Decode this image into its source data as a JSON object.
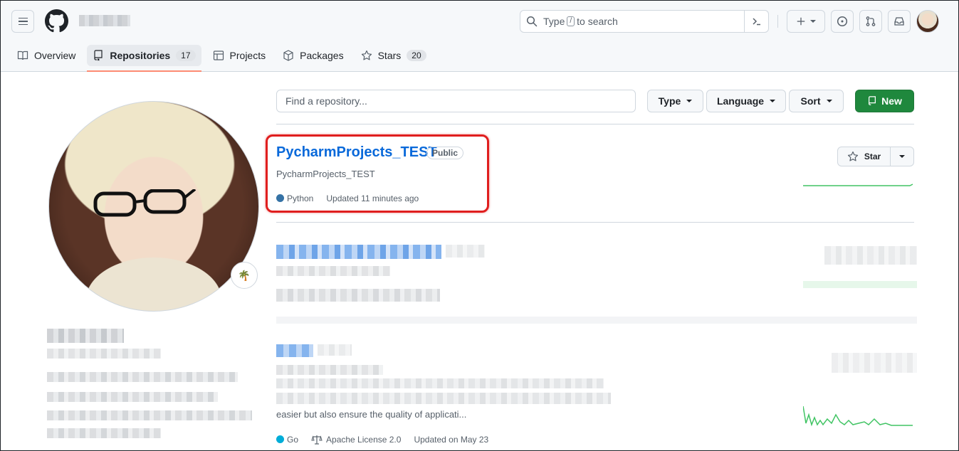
{
  "header": {
    "search_prefix": "Type",
    "search_key": "/",
    "search_suffix": "to search"
  },
  "tabs": [
    {
      "label": "Overview",
      "count": null
    },
    {
      "label": "Repositories",
      "count": "17"
    },
    {
      "label": "Projects",
      "count": null
    },
    {
      "label": "Packages",
      "count": null
    },
    {
      "label": "Stars",
      "count": "20"
    }
  ],
  "filters": {
    "find_placeholder": "Find a repository...",
    "type_label": "Type",
    "language_label": "Language",
    "sort_label": "Sort",
    "new_label": "New"
  },
  "repos": [
    {
      "name": "PycharmProjects_TEST",
      "visibility": "Public",
      "description": "PycharmProjects_TEST",
      "language": "Python",
      "language_color": "#3572A5",
      "updated": "Updated 11 minutes ago",
      "star_label": "Star"
    },
    {
      "description_tail": "easier but also ensure the quality of applicati...",
      "language": "Go",
      "language_color": "#00ADD8",
      "license": "Apache License 2.0",
      "updated": "Updated on May 23"
    }
  ],
  "profile": {
    "status_emoji": "🌴"
  },
  "colors": {
    "accent_blue": "#0969da",
    "new_green": "#1f883d",
    "highlight_red": "#e01e1e",
    "tab_underline": "#fd8c73"
  }
}
